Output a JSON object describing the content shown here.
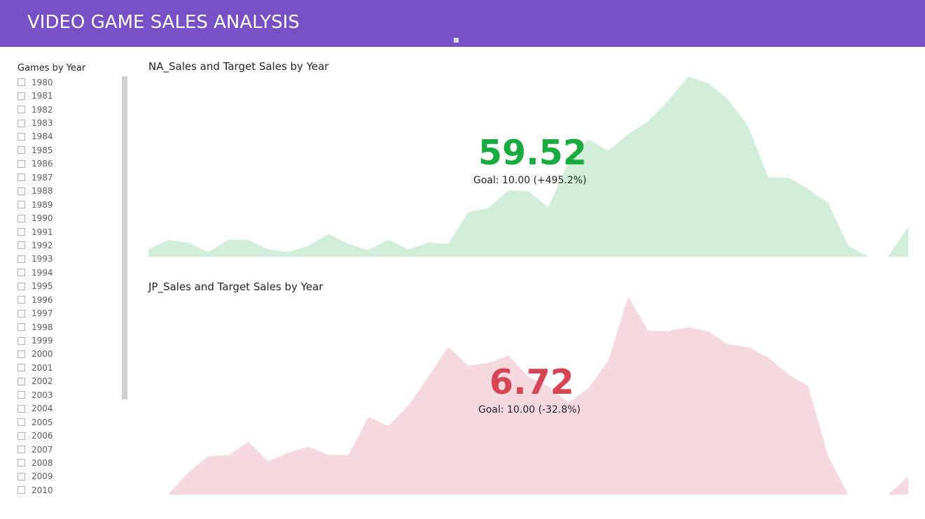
{
  "header": {
    "title": "VIDEO GAME SALES ANALYSIS",
    "background": "#7750c5"
  },
  "slicer": {
    "title": "Games by Year",
    "years": [
      "1980",
      "1981",
      "1982",
      "1983",
      "1984",
      "1985",
      "1986",
      "1987",
      "1988",
      "1989",
      "1990",
      "1991",
      "1992",
      "1993",
      "1994",
      "1995",
      "1996",
      "1997",
      "1998",
      "1999",
      "2000",
      "2001",
      "2002",
      "2003",
      "2004",
      "2005",
      "2006",
      "2007",
      "2008",
      "2009",
      "2010"
    ]
  },
  "chart_data": [
    {
      "type": "area",
      "title": "NA_Sales and Target Sales by Year",
      "kpi": {
        "value": "59.52",
        "goal_text": "Goal: 10.00 (+495.2%)",
        "status_icon": "check-icon",
        "status_glyph": "✓",
        "color": "#1aab40"
      },
      "fill_color": "#d0eed9",
      "ylim": [
        0,
        59.52
      ],
      "values": [
        2.4,
        5.5,
        4.6,
        1.5,
        5.6,
        5.6,
        2.4,
        1.5,
        3.6,
        7.5,
        4.2,
        2.2,
        5.6,
        2.4,
        4.6,
        4.2,
        14.8,
        16.0,
        21.9,
        21.6,
        16.3,
        31.0,
        38.7,
        35.0,
        40.4,
        44.7,
        51.5,
        59.5,
        57.2,
        51.8,
        43.0,
        26.1,
        26.1,
        22.3,
        17.6,
        3.6,
        -1.0,
        -1.0,
        9.8
      ],
      "breaks": [
        36,
        37
      ]
    },
    {
      "type": "area",
      "title": "JP_Sales and Target Sales by Year",
      "kpi": {
        "value": "6.72",
        "goal_text": "Goal: 10.00 (-32.8%)",
        "status_icon": "exclamation-icon",
        "status_glyph": "!",
        "color": "#d64554"
      },
      "fill_color": "#f6d9de",
      "ylim": [
        0,
        6.72
      ],
      "values": [
        -1.0,
        -1.0,
        0.75,
        1.31,
        1.33,
        1.79,
        1.13,
        1.42,
        1.62,
        1.35,
        1.34,
        2.62,
        2.33,
        3.02,
        4.0,
        5.01,
        4.38,
        4.46,
        4.72,
        4.0,
        3.67,
        3.13,
        3.6,
        4.54,
        6.72,
        5.56,
        5.55,
        5.68,
        5.53,
        5.1,
        5.0,
        4.65,
        4.08,
        3.68,
        1.3,
        -1.0,
        -1.0,
        -1.0,
        0.6
      ],
      "breaks": [
        0,
        1,
        35,
        36,
        37
      ]
    }
  ]
}
